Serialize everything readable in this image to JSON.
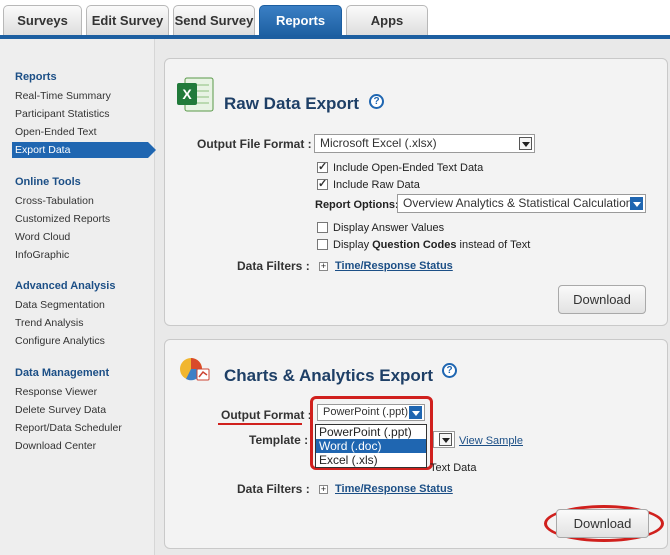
{
  "tabs": [
    {
      "label": "Surveys",
      "active": false
    },
    {
      "label": "Edit Survey",
      "active": false
    },
    {
      "label": "Send Survey",
      "active": false
    },
    {
      "label": "Reports",
      "active": true
    },
    {
      "label": "Apps",
      "active": false
    }
  ],
  "sidebar": {
    "sections": [
      {
        "title": "Reports",
        "items": [
          "Real-Time Summary",
          "Participant Statistics",
          "Open-Ended Text",
          "Export Data"
        ]
      },
      {
        "title": "Online Tools",
        "items": [
          "Cross-Tabulation",
          "Customized Reports",
          "Word Cloud",
          "InfoGraphic"
        ]
      },
      {
        "title": "Advanced Analysis",
        "items": [
          "Data Segmentation",
          "Trend Analysis",
          "Configure Analytics"
        ]
      },
      {
        "title": "Data Management",
        "items": [
          "Response Viewer",
          "Delete Survey Data",
          "Report/Data Scheduler",
          "Download Center"
        ]
      }
    ],
    "active_item": "Export Data"
  },
  "raw_export": {
    "title": "Raw Data Export",
    "help": "?",
    "format_label": "Output File Format :",
    "format_value": "Microsoft Excel (.xlsx)",
    "opt_open_ended": "Include Open-Ended Text Data",
    "opt_raw": "Include Raw Data",
    "report_options_label": "Report Options:",
    "report_options_value": "Overview Analytics & Statistical Calculations",
    "opt_answer_values": "Display Answer Values",
    "opt_question_codes_pre": "Display ",
    "opt_question_codes_bold": "Question Codes",
    "opt_question_codes_post": " instead of Text",
    "filters_label": "Data Filters :",
    "filters_plus": "+",
    "filters_link": "Time/Response Status",
    "download_label": "Download"
  },
  "charts_export": {
    "title": "Charts & Analytics Export",
    "help": "?",
    "format_label": "Output Format :",
    "format_value": "PowerPoint (.ppt)",
    "dropdown_options": [
      "PowerPoint (.ppt)",
      "Word (.doc)",
      "Excel (.xls)"
    ],
    "dropdown_highlighted": "Word (.doc)",
    "template_label": "Template :",
    "view_sample": "View Sample",
    "partial_text": "Text Data",
    "filters_label": "Data Filters :",
    "filters_plus": "+",
    "filters_link": "Time/Response Status",
    "download_label": "Download"
  },
  "colors": {
    "accent": "#1f66b1",
    "annotation_red": "#d0201d",
    "title": "#1e3f66"
  }
}
